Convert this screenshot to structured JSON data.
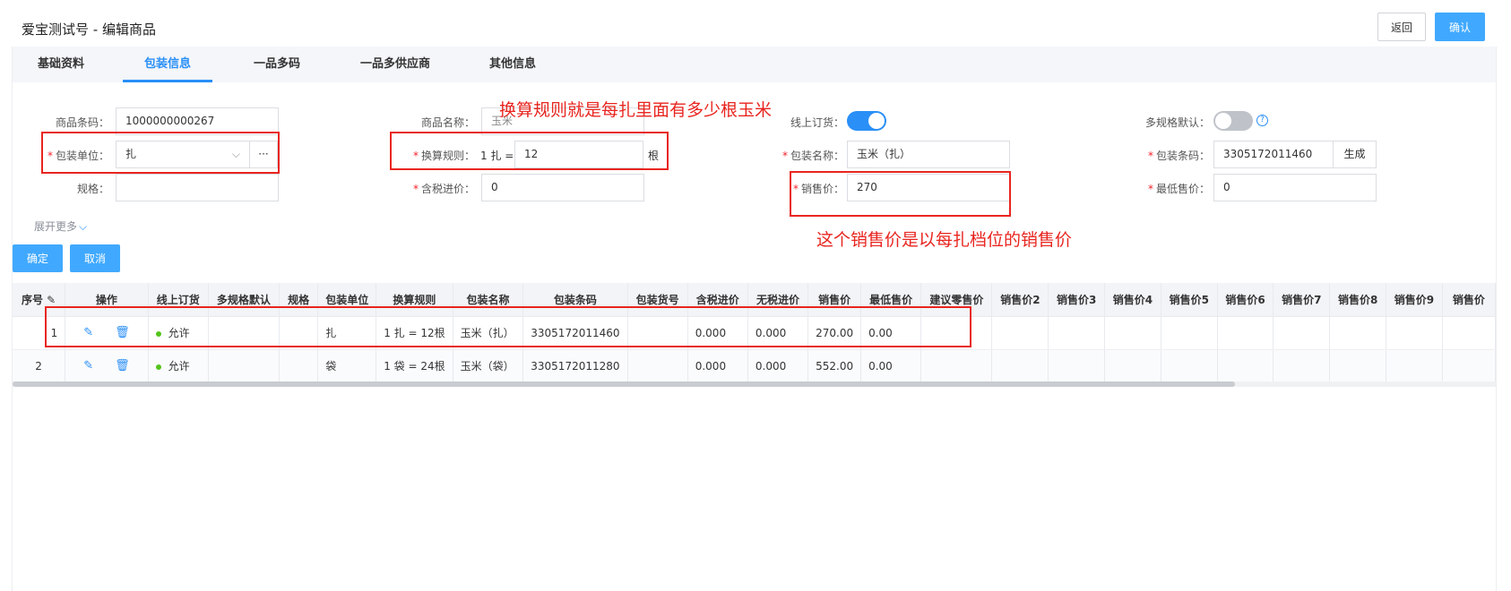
{
  "header": {
    "title": "爱宝测试号 - 编辑商品",
    "back_label": "返回",
    "confirm_label": "确认"
  },
  "tabs": [
    {
      "label": "基础资料",
      "active": false
    },
    {
      "label": "包装信息",
      "active": true
    },
    {
      "label": "一品多码",
      "active": false
    },
    {
      "label": "一品多供应商",
      "active": false
    },
    {
      "label": "其他信息",
      "active": false
    }
  ],
  "form": {
    "barcode": {
      "label": "商品条码：",
      "value": "1000000000267"
    },
    "product_name": {
      "label": "商品名称：",
      "value": "玉米"
    },
    "online_order": {
      "label": "线上订货：",
      "on": true
    },
    "multi_spec_default": {
      "label": "多规格默认：",
      "on": false,
      "help": "?"
    },
    "pack_unit": {
      "label": "包装单位：",
      "value": "扎",
      "more": "···"
    },
    "conversion": {
      "label": "换算规则：",
      "prefix": "1 扎 =",
      "value": "12",
      "suffix": "根"
    },
    "pack_name": {
      "label": "包装名称：",
      "value": "玉米（扎）"
    },
    "pack_barcode": {
      "label": "包装条码：",
      "value": "3305172011460",
      "generate": "生成"
    },
    "spec": {
      "label": "规格：",
      "value": ""
    },
    "tax_purchase": {
      "label": "含税进价：",
      "value": "0"
    },
    "sale_price": {
      "label": "销售价：",
      "value": "270"
    },
    "min_price": {
      "label": "最低售价：",
      "value": "0"
    },
    "expand_label": "展开更多",
    "ok_label": "确定",
    "cancel_label": "取消"
  },
  "table": {
    "columns": [
      "序号",
      "操作",
      "线上订货",
      "多规格默认",
      "规格",
      "包装单位",
      "换算规则",
      "包装名称",
      "包装条码",
      "包装货号",
      "含税进价",
      "无税进价",
      "销售价",
      "最低售价",
      "建议零售价",
      "销售价2",
      "销售价3",
      "销售价4",
      "销售价5",
      "销售价6",
      "销售价7",
      "销售价8",
      "销售价9",
      "销售价"
    ],
    "rows": [
      {
        "index": "1",
        "online": "允许",
        "multi": "",
        "spec": "",
        "unit": "扎",
        "rule": "1 扎 = 12根",
        "name": "玉米（扎）",
        "barcode": "3305172011460",
        "code": "",
        "tax_in": "0.000",
        "notax_in": "0.000",
        "sale": "270.00",
        "min": "0.00"
      },
      {
        "index": "2",
        "online": "允许",
        "multi": "",
        "spec": "",
        "unit": "袋",
        "rule": "1 袋 = 24根",
        "name": "玉米（袋）",
        "barcode": "3305172011280",
        "code": "",
        "tax_in": "0.000",
        "notax_in": "0.000",
        "sale": "552.00",
        "min": "0.00"
      }
    ]
  },
  "annotations": {
    "conversion_note": "换算规则就是每扎里面有多少根玉米",
    "price_note": "这个销售价是以每扎档位的销售价"
  },
  "colors": {
    "accent": "#2a8ff7",
    "button_blue": "#40a9ff",
    "annotation_red": "#e8251f",
    "status_green": "#52c41a"
  }
}
